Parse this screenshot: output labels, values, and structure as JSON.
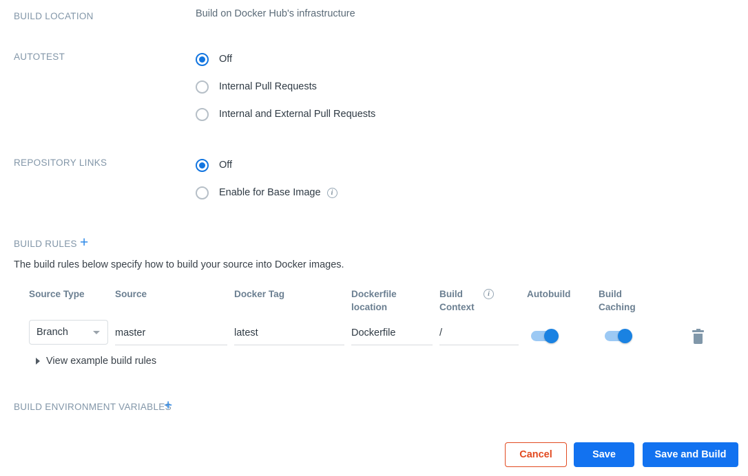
{
  "sections": {
    "build_location": {
      "label": "BUILD LOCATION",
      "value": "Build on Docker Hub's infrastructure"
    },
    "autotest": {
      "label": "AUTOTEST",
      "options": [
        {
          "label": "Off",
          "selected": true
        },
        {
          "label": "Internal Pull Requests",
          "selected": false
        },
        {
          "label": "Internal and External Pull Requests",
          "selected": false
        }
      ]
    },
    "repository_links": {
      "label": "REPOSITORY LINKS",
      "options": [
        {
          "label": "Off",
          "selected": true
        },
        {
          "label": "Enable for Base Image",
          "selected": false,
          "info": true
        }
      ]
    },
    "build_rules": {
      "label": "BUILD RULES",
      "add_label": "+",
      "description": "The build rules below specify how to build your source into Docker images.",
      "columns": [
        "Source Type",
        "Source",
        "Docker Tag",
        "Dockerfile location",
        "Build Context",
        "Autobuild",
        "Build Caching"
      ],
      "build_context_info": true,
      "rows": [
        {
          "source_type": "Branch",
          "source": "master",
          "docker_tag": "latest",
          "dockerfile_location": "Dockerfile",
          "build_context": "/",
          "autobuild": true,
          "build_caching": true,
          "delete_icon": "trash-icon"
        }
      ],
      "expander_label": "View example build rules"
    },
    "build_env_vars": {
      "label": "BUILD ENVIRONMENT VARIABLES",
      "add_label": "+"
    }
  },
  "footer": {
    "cancel_label": "Cancel",
    "save_label": "Save",
    "save_and_build_label": "Save and Build"
  },
  "colors": {
    "accent_blue": "#1272f0",
    "link_blue": "#2f8ae8",
    "label_gray": "#8296a8",
    "cancel_red": "#e2491f",
    "toggle_track": "#9cc9f4",
    "toggle_knob": "#1a82e2"
  }
}
